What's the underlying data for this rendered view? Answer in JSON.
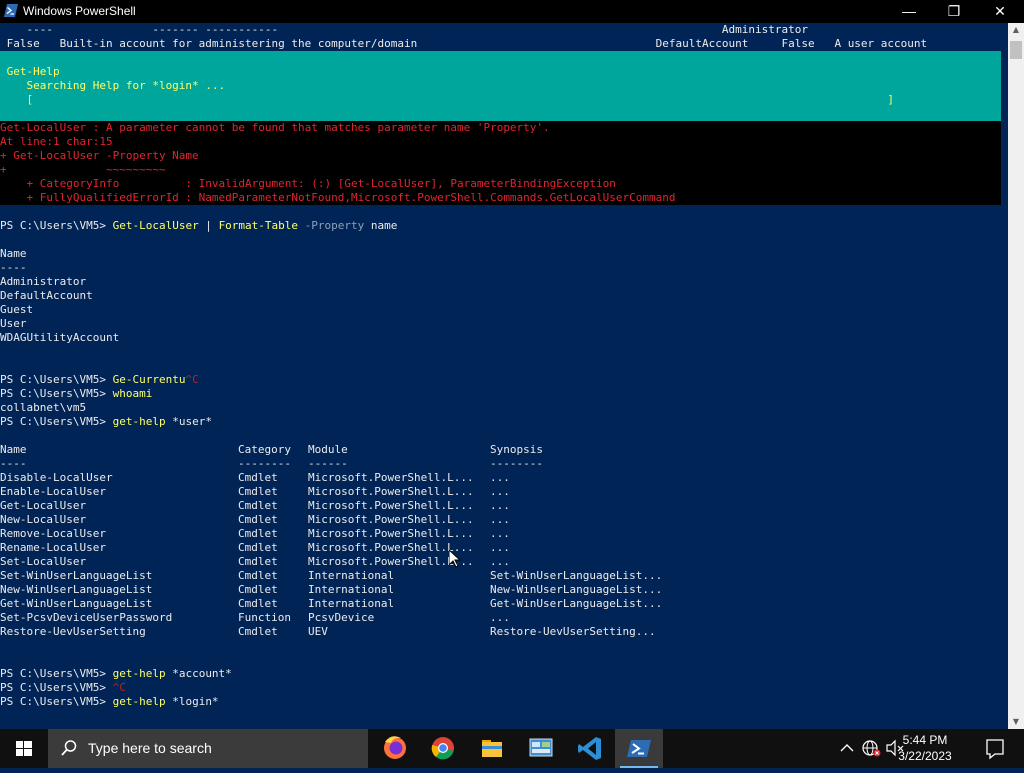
{
  "window": {
    "title": "Windows PowerShell",
    "minimize": "—",
    "maximize": "❐",
    "close": "✕"
  },
  "console": {
    "top_lines": [
      "    ----               ------- -----------                                                                   Administrator",
      " False   Built-in account for administering the computer/domain                                    DefaultAccount     False   A user account"
    ],
    "progress": {
      "activity": " Get-Help",
      "status": "    Searching Help for *login* ...",
      "bar": "    [                                                                                                                                 ]"
    },
    "error": [
      "Get-LocalUser : A parameter cannot be found that matches parameter name 'Property'.",
      "At line:1 char:15",
      "+ Get-LocalUser -Property Name",
      "+               ~~~~~~~~~",
      "    + CategoryInfo          : InvalidArgument: (:) [Get-LocalUser], ParameterBindingException",
      "    + FullyQualifiedErrorId : NamedParameterNotFound,Microsoft.PowerShell.Commands.GetLocalUserCommand"
    ],
    "cmd1": {
      "prompt": "PS C:\\Users\\VM5> ",
      "c1": "Get-LocalUser",
      "pipe": " | ",
      "c2": "Format-Table",
      "param": " -Property",
      "arg": " name"
    },
    "name_header": "Name",
    "name_rule": "----",
    "names": [
      "Administrator",
      "DefaultAccount",
      "Guest",
      "User",
      "WDAGUtilityAccount"
    ],
    "cmd2": {
      "prompt": "PS C:\\Users\\VM5> ",
      "text": "Ge-Currentu",
      "ctrlc": "^C"
    },
    "cmd3": {
      "prompt": "PS C:\\Users\\VM5> ",
      "text": "whoami"
    },
    "whoami_out": "collabnet\\vm5",
    "cmd4": {
      "prompt": "PS C:\\Users\\VM5> ",
      "text": "get-help",
      "arg": " *user*"
    },
    "help_header": {
      "name": "Name",
      "category": "Category",
      "module": "Module",
      "synopsis": "Synopsis"
    },
    "help_rule": {
      "name": "----",
      "category": "--------",
      "module": "------",
      "synopsis": "--------"
    },
    "help_rows": [
      {
        "name": "Disable-LocalUser",
        "category": "Cmdlet",
        "module": "Microsoft.PowerShell.L...",
        "synopsis": "..."
      },
      {
        "name": "Enable-LocalUser",
        "category": "Cmdlet",
        "module": "Microsoft.PowerShell.L...",
        "synopsis": "..."
      },
      {
        "name": "Get-LocalUser",
        "category": "Cmdlet",
        "module": "Microsoft.PowerShell.L...",
        "synopsis": "..."
      },
      {
        "name": "New-LocalUser",
        "category": "Cmdlet",
        "module": "Microsoft.PowerShell.L...",
        "synopsis": "..."
      },
      {
        "name": "Remove-LocalUser",
        "category": "Cmdlet",
        "module": "Microsoft.PowerShell.L...",
        "synopsis": "..."
      },
      {
        "name": "Rename-LocalUser",
        "category": "Cmdlet",
        "module": "Microsoft.PowerShell.L...",
        "synopsis": "..."
      },
      {
        "name": "Set-LocalUser",
        "category": "Cmdlet",
        "module": "Microsoft.PowerShell.L...",
        "synopsis": "..."
      },
      {
        "name": "Set-WinUserLanguageList",
        "category": "Cmdlet",
        "module": "International",
        "synopsis": "Set-WinUserLanguageList..."
      },
      {
        "name": "New-WinUserLanguageList",
        "category": "Cmdlet",
        "module": "International",
        "synopsis": "New-WinUserLanguageList..."
      },
      {
        "name": "Get-WinUserLanguageList",
        "category": "Cmdlet",
        "module": "International",
        "synopsis": "Get-WinUserLanguageList..."
      },
      {
        "name": "Set-PcsvDeviceUserPassword",
        "category": "Function",
        "module": "PcsvDevice",
        "synopsis": "..."
      },
      {
        "name": "Restore-UevUserSetting",
        "category": "Cmdlet",
        "module": "UEV",
        "synopsis": "Restore-UevUserSetting..."
      }
    ],
    "cmd5": {
      "prompt": "PS C:\\Users\\VM5> ",
      "text": "get-help",
      "arg": " *account*"
    },
    "cmd6": {
      "prompt": "PS C:\\Users\\VM5> ",
      "ctrlc": "^C"
    },
    "cmd7": {
      "prompt": "PS C:\\Users\\VM5> ",
      "text": "get-help",
      "arg": " *login*"
    }
  },
  "taskbar": {
    "search_placeholder": "Type here to search",
    "apps": [
      "firefox-icon",
      "chrome-icon",
      "file-explorer-icon",
      "control-panel-icon",
      "visual-studio-code-icon",
      "powershell-icon"
    ],
    "clock_time": "5:44 PM",
    "clock_date": "3/22/2023"
  },
  "colors": {
    "console_bg": "#012456",
    "progress_bg": "#00a69c",
    "error_text": "#e0252f",
    "command_yellow": "#ffff66",
    "taskbar_bg": "#101010"
  }
}
